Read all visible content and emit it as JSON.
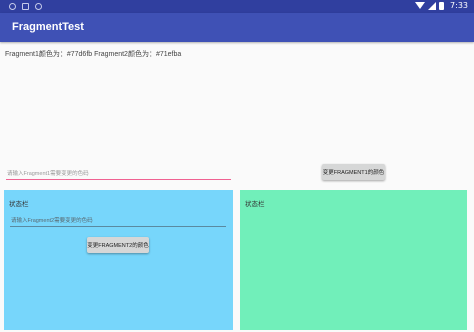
{
  "status_bar": {
    "time": "7:33",
    "icons": [
      "notification-icon",
      "settings-icon",
      "sync-icon",
      "wifi-icon",
      "signal-icon",
      "battery-icon"
    ]
  },
  "app_bar": {
    "title": "FragmentTest"
  },
  "main": {
    "color_info": "Fragment1颜色为：#77d6fb Fragment2颜色为：#71efba",
    "fragment1_input_placeholder": "请输入Fragment1需要变更的色码",
    "change_fragment1_button": "变更FRAGMENT1的颜色"
  },
  "fragment1": {
    "status_label": "状态栏",
    "input_placeholder": "请输入Fragment2需要变更的色码",
    "change_fragment2_button": "变更FRAGMENT2的颜色",
    "background": "#77d6fb"
  },
  "fragment2": {
    "status_label": "状态栏",
    "background": "#71efba"
  },
  "colors": {
    "status_bar": "#303f9f",
    "app_bar": "#3f51b5",
    "input_underline": "#f06292"
  }
}
